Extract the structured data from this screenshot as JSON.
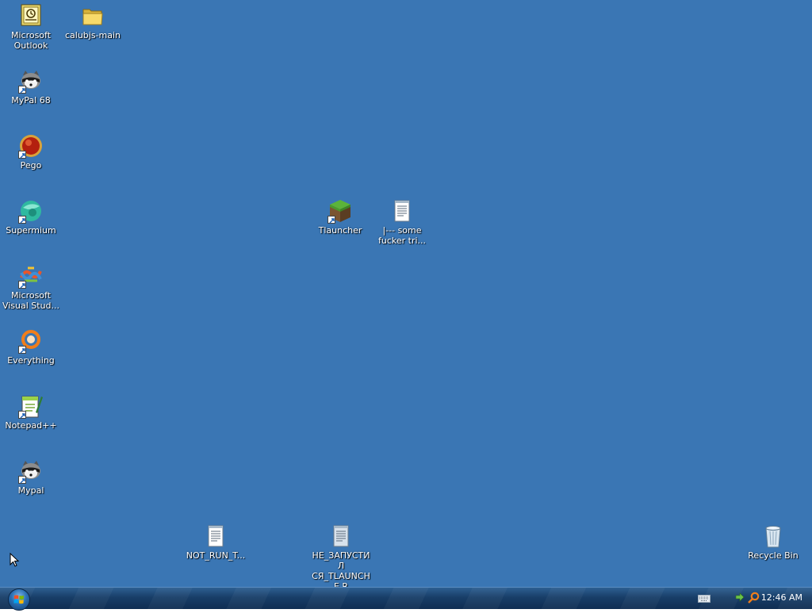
{
  "desktop": {
    "icons": [
      {
        "label": "Microsoft Outlook",
        "icon": "outlook-icon"
      },
      {
        "label": "calubjs-main",
        "icon": "folder-icon"
      },
      {
        "label": "MyPal 68",
        "icon": "raccoon-icon"
      },
      {
        "label": "Pego",
        "icon": "pego-icon"
      },
      {
        "label": "Supermium",
        "icon": "supermium-icon"
      },
      {
        "label": "Microsoft Visual Stud...",
        "icon": "visual-studio-icon"
      },
      {
        "label": "Everything",
        "icon": "everything-icon"
      },
      {
        "label": "Notepad++",
        "icon": "notepadpp-icon"
      },
      {
        "label": "Mypal",
        "icon": "raccoon-icon"
      },
      {
        "label": "Tlauncher",
        "icon": "minecraft-block-icon"
      },
      {
        "label": "|--- some fucker tri...",
        "icon": "text-file-icon"
      },
      {
        "label": "NOT_RUN_T...",
        "icon": "text-file-icon"
      },
      {
        "label": "НЕ_ЗАПУСТИЛ СЯ_TLAUNCHE R",
        "icon": "text-file-icon"
      },
      {
        "label": "Recycle Bin",
        "icon": "recycle-bin-icon"
      }
    ]
  },
  "taskbar": {
    "clock": "12:46 AM",
    "tray_icons": [
      "keyboard-icon",
      "network-icon",
      "search-icon"
    ]
  },
  "colors": {
    "desktop_background": "#3a76b4",
    "taskbar": "#183e68"
  }
}
